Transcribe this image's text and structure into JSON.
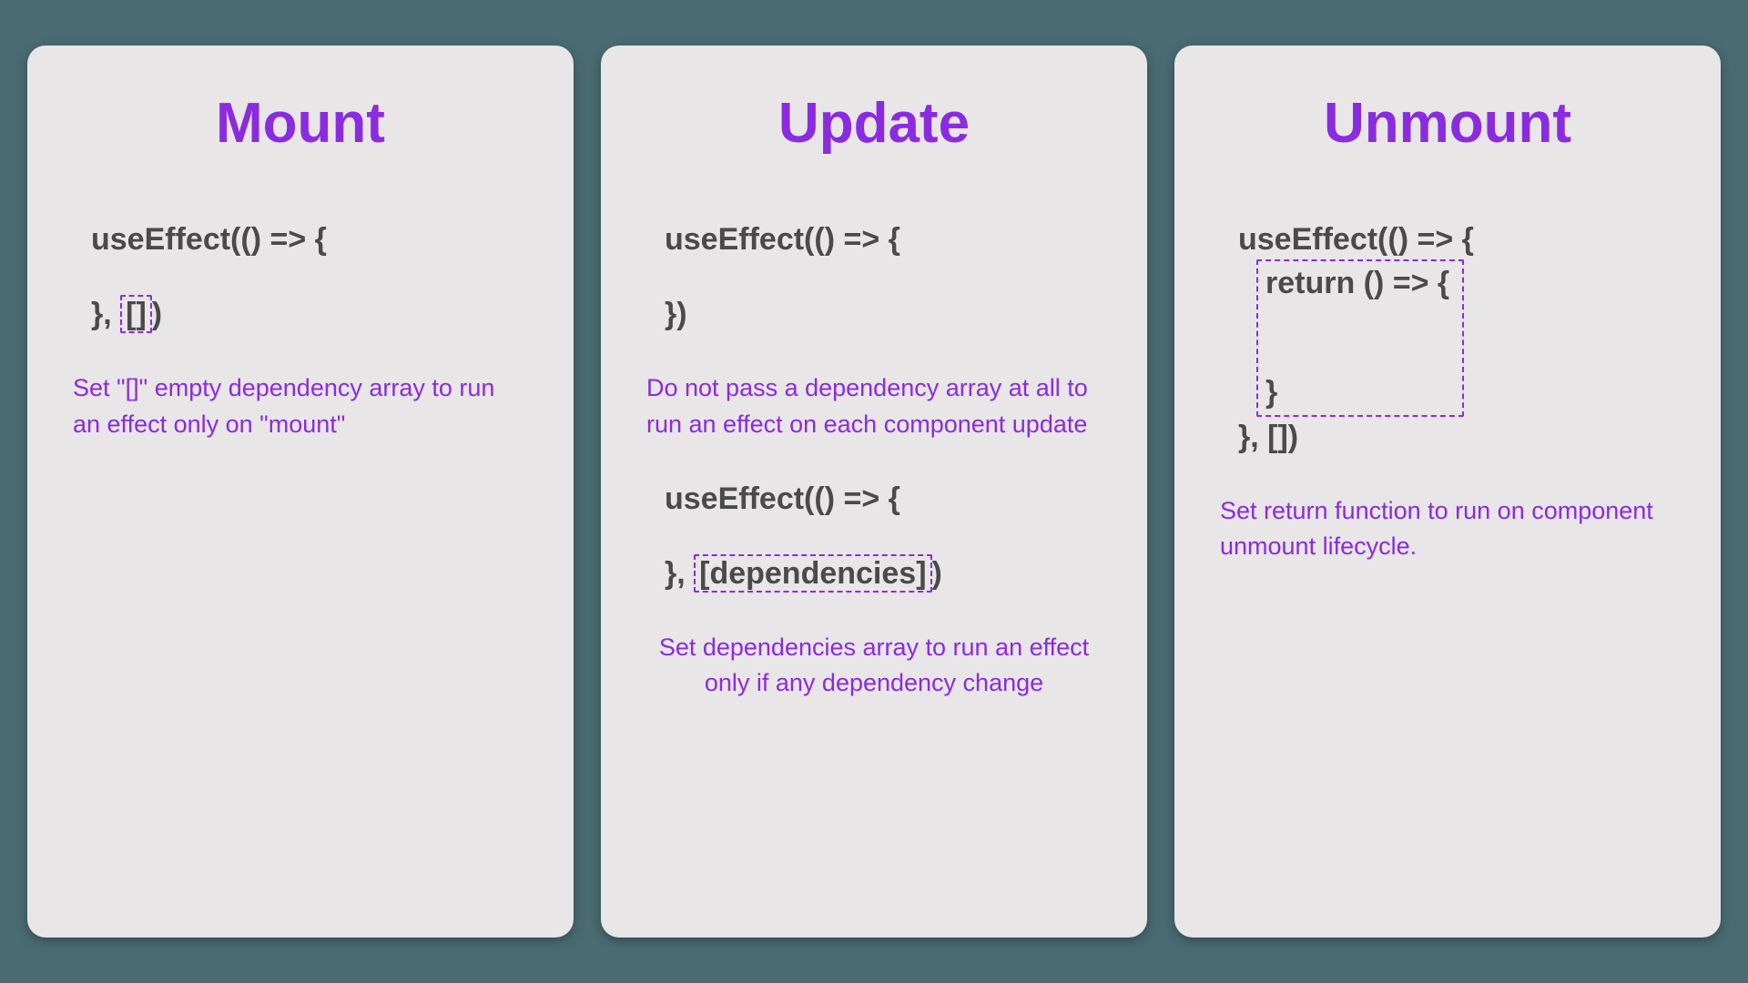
{
  "cards": {
    "mount": {
      "title": "Mount",
      "code": {
        "line1": "useEffect(() => {",
        "line2_prefix": "}, ",
        "line2_highlight": "[]",
        "line2_suffix": ")"
      },
      "description": "Set \"[]\" empty dependency array to run an effect only on \"mount\""
    },
    "update": {
      "title": "Update",
      "code1": {
        "line1": "useEffect(() => {",
        "line2": "})"
      },
      "description1": "Do not pass a dependency array at all to run an effect on each component update",
      "code2": {
        "line1": "useEffect(() => {",
        "line2_prefix": "}, ",
        "line2_highlight": "[dependencies]",
        "line2_suffix": ")"
      },
      "description2": "Set dependencies array to run an effect only if any dependency change"
    },
    "unmount": {
      "title": "Unmount",
      "code": {
        "line1": "useEffect(() => {",
        "return_line1": "return () => {",
        "return_line2": "}",
        "line_end": "}, [])"
      },
      "description": "Set return function to run on component unmount lifecycle."
    }
  }
}
